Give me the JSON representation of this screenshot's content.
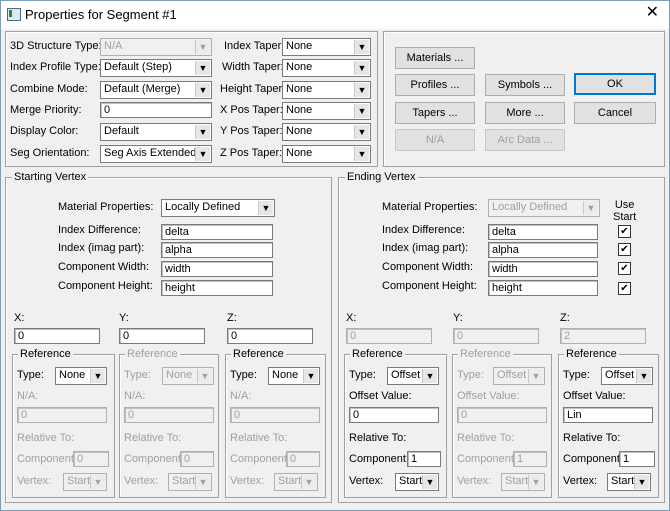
{
  "window": {
    "title": "Properties for Segment #1",
    "close_glyph": "✕"
  },
  "top": {
    "structure_type": {
      "label": "3D Structure Type:",
      "value": "N/A"
    },
    "index_profile_type": {
      "label": "Index Profile Type:",
      "value": "Default (Step)"
    },
    "combine_mode": {
      "label": "Combine Mode:",
      "value": "Default (Merge)"
    },
    "merge_priority": {
      "label": "Merge Priority:",
      "value": "0"
    },
    "display_color": {
      "label": "Display Color:",
      "value": "Default"
    },
    "seg_orientation": {
      "label": "Seg Orientation:",
      "value": "Seg Axis Extended"
    },
    "index_taper": {
      "label": "Index Taper:",
      "value": "None"
    },
    "width_taper": {
      "label": "Width Taper:",
      "value": "None"
    },
    "height_taper": {
      "label": "Height Taper:",
      "value": "None"
    },
    "xpos_taper": {
      "label": "X Pos Taper:",
      "value": "None"
    },
    "ypos_taper": {
      "label": "Y Pos Taper:",
      "value": "None"
    },
    "zpos_taper": {
      "label": "Z Pos Taper:",
      "value": "None"
    }
  },
  "buttons": {
    "materials": "Materials ...",
    "profiles": "Profiles ...",
    "tapers": "Tapers ...",
    "na": "N/A",
    "symbols": "Symbols ...",
    "more": "More ...",
    "arc_data": "Arc Data ...",
    "ok": "OK",
    "cancel": "Cancel"
  },
  "start_vertex": {
    "title": "Starting Vertex",
    "material_label": "Material Properties:",
    "material_value": "Locally Defined",
    "index_diff_label": "Index Difference:",
    "index_diff": "delta",
    "index_imag_label": "Index (imag part):",
    "index_imag": "alpha",
    "comp_width_label": "Component Width:",
    "comp_width": "width",
    "comp_height_label": "Component Height:",
    "comp_height": "height",
    "x_label": "X:",
    "x": "0",
    "y_label": "Y:",
    "y": "0",
    "z_label": "Z:",
    "z": "0",
    "refs": [
      {
        "title": "Reference",
        "type_label": "Type:",
        "type": "None",
        "field_label": "N/A:",
        "field": "0",
        "rel_label": "Relative To:",
        "comp_label": "Component:",
        "comp": "0",
        "vertex_label": "Vertex:",
        "vertex": "Start"
      },
      {
        "title": "Reference",
        "type_label": "Type:",
        "type": "None",
        "field_label": "N/A:",
        "field": "0",
        "rel_label": "Relative To:",
        "comp_label": "Component:",
        "comp": "0",
        "vertex_label": "Vertex:",
        "vertex": "Start"
      },
      {
        "title": "Reference",
        "type_label": "Type:",
        "type": "None",
        "field_label": "N/A:",
        "field": "0",
        "rel_label": "Relative To:",
        "comp_label": "Component:",
        "comp": "0",
        "vertex_label": "Vertex:",
        "vertex": "Start"
      }
    ]
  },
  "end_vertex": {
    "title": "Ending Vertex",
    "use_start_label": "Use\nStart",
    "material_label": "Material Properties:",
    "material_value": "Locally Defined",
    "index_diff_label": "Index Difference:",
    "index_diff": "delta",
    "index_imag_label": "Index (imag part):",
    "index_imag": "alpha",
    "comp_width_label": "Component Width:",
    "comp_width": "width",
    "comp_height_label": "Component Height:",
    "comp_height": "height",
    "check_glyph": "✔",
    "x_label": "X:",
    "x": "0",
    "y_label": "Y:",
    "y": "0",
    "z_label": "Z:",
    "z": "2",
    "refs": [
      {
        "title": "Reference",
        "type_label": "Type:",
        "type": "Offset",
        "field_label": "Offset Value:",
        "field": "0",
        "rel_label": "Relative To:",
        "comp_label": "Component:",
        "comp": "1",
        "vertex_label": "Vertex:",
        "vertex": "Start"
      },
      {
        "title": "Reference",
        "type_label": "Type:",
        "type": "Offset",
        "field_label": "Offset Value:",
        "field": "0",
        "rel_label": "Relative To:",
        "comp_label": "Component:",
        "comp": "1",
        "vertex_label": "Vertex:",
        "vertex": "Start"
      },
      {
        "title": "Reference",
        "type_label": "Type:",
        "type": "Offset",
        "field_label": "Offset Value:",
        "field": "Lin",
        "rel_label": "Relative To:",
        "comp_label": "Component:",
        "comp": "1",
        "vertex_label": "Vertex:",
        "vertex": "Start"
      }
    ]
  }
}
